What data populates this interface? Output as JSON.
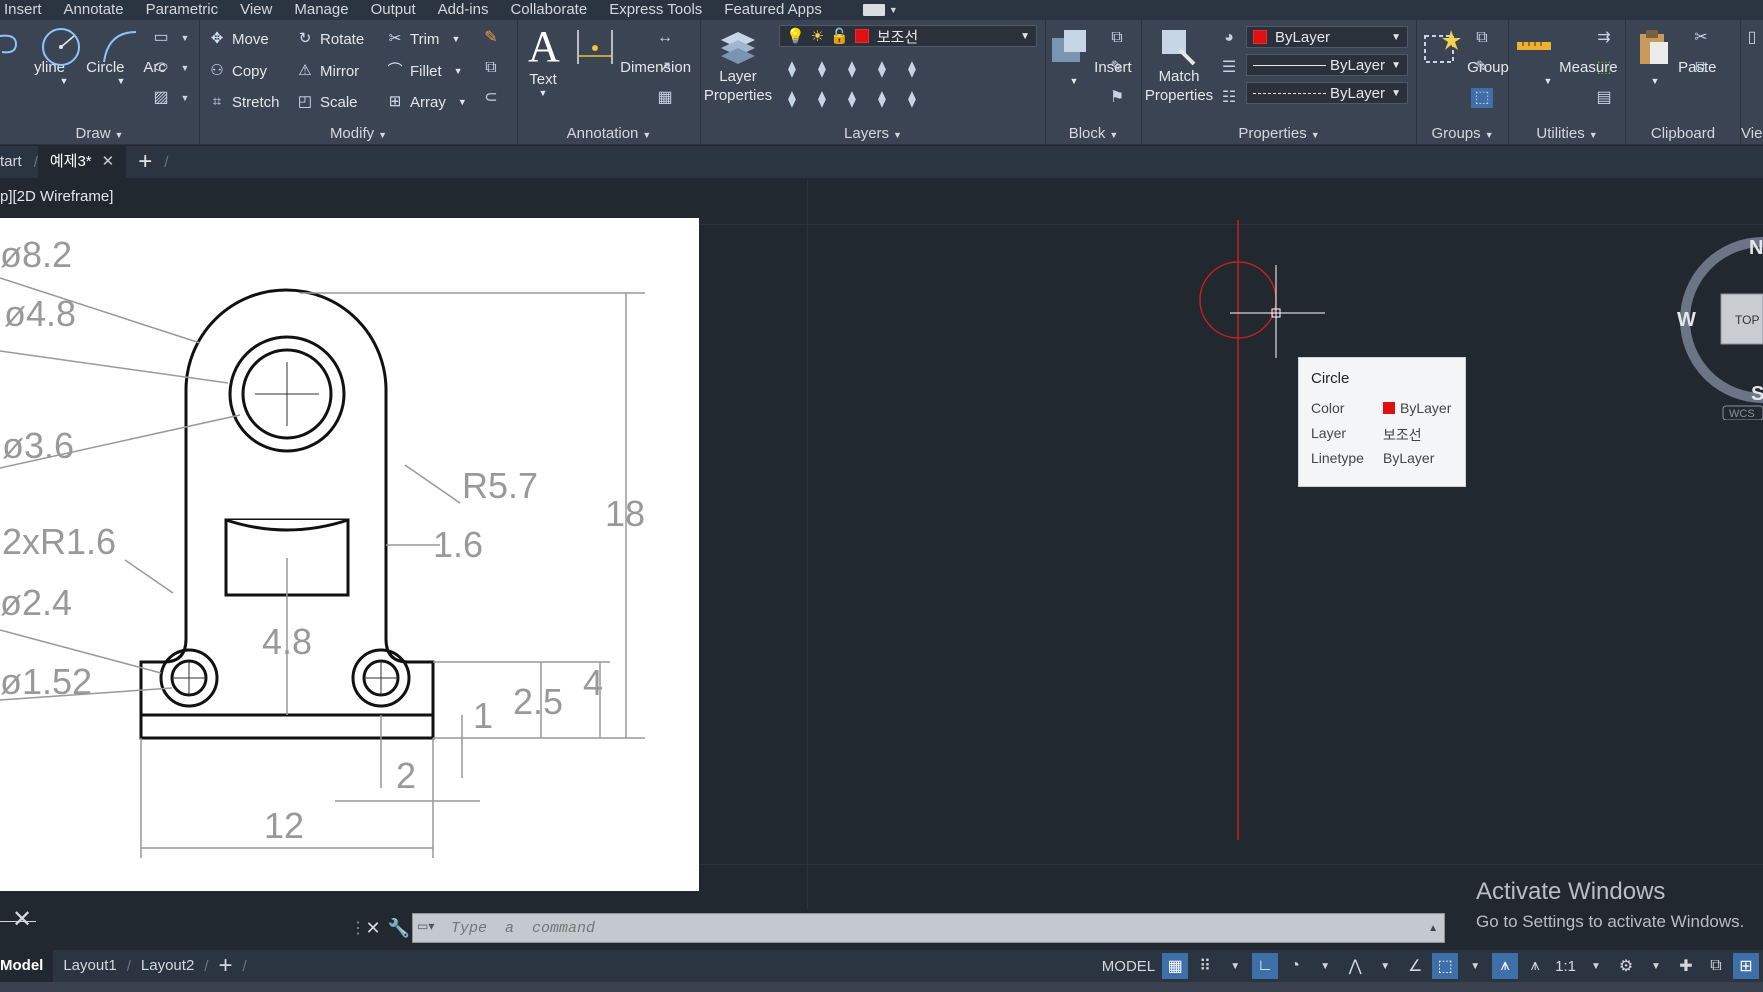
{
  "menu_tabs": [
    "Insert",
    "Annotate",
    "Parametric",
    "View",
    "Manage",
    "Output",
    "Add-ins",
    "Collaborate",
    "Express Tools",
    "Featured Apps"
  ],
  "ribbon": {
    "draw": {
      "title": "Draw",
      "polyline": "yline",
      "circle": "Circle",
      "arc": "Arc"
    },
    "modify": {
      "title": "Modify",
      "move": "Move",
      "rotate": "Rotate",
      "trim": "Trim",
      "copy": "Copy",
      "mirror": "Mirror",
      "fillet": "Fillet",
      "stretch": "Stretch",
      "scale": "Scale",
      "array": "Array"
    },
    "annotation": {
      "title": "Annotation",
      "text": "Text",
      "dimension": "Dimension"
    },
    "layers": {
      "title": "Layers",
      "layer_properties_1": "Layer",
      "layer_properties_2": "Properties",
      "current_layer": "보조선"
    },
    "block": {
      "title": "Block",
      "insert": "Insert"
    },
    "properties": {
      "title": "Properties",
      "match_1": "Match",
      "match_2": "Properties",
      "color": "ByLayer",
      "lineweight": "ByLayer",
      "linetype": "ByLayer"
    },
    "groups": {
      "title": "Groups",
      "group": "Group"
    },
    "utilities": {
      "title": "Utilities",
      "measure": "Measure"
    },
    "clipboard": {
      "title": "Clipboard",
      "paste": "Paste"
    },
    "view": {
      "title": "Vie"
    }
  },
  "file_tabs": {
    "start": "tart",
    "active": "예제3*",
    "plus": "+"
  },
  "viewport": {
    "label": "p][2D Wireframe]",
    "tooltip": {
      "title": "Circle",
      "color_key": "Color",
      "color_val": "ByLayer",
      "layer_key": "Layer",
      "layer_val": "보조선",
      "linetype_key": "Linetype",
      "linetype_val": "ByLayer"
    },
    "viewcube": {
      "n": "N",
      "w": "W",
      "s": "S",
      "top": "TOP",
      "wcs": "WCS"
    },
    "ref_drawing": {
      "d82": "ø8.2",
      "d48": "ø4.8",
      "d36": "ø3.6",
      "r57": "R5.7",
      "r16": "2xR1.6",
      "d24": "ø2.4",
      "d152": "ø1.52",
      "h18": "18",
      "w16": "1.6",
      "h48": "4.8",
      "h4": "4",
      "h25": "2.5",
      "h1": "1",
      "w2": "2",
      "w12": "12"
    }
  },
  "watermark": {
    "line1": "Activate Windows",
    "line2": "Go to Settings to activate Windows."
  },
  "command": {
    "placeholder": "Type  a  command"
  },
  "layout_tabs": {
    "model": "Model",
    "layout1": "Layout1",
    "layout2": "Layout2",
    "plus": "+"
  },
  "status": {
    "model": "MODEL",
    "scale": "1:1"
  },
  "colors": {
    "accent": "#3f6fa8",
    "crosshair": "#c81e1e",
    "swatch": "#e01010"
  }
}
